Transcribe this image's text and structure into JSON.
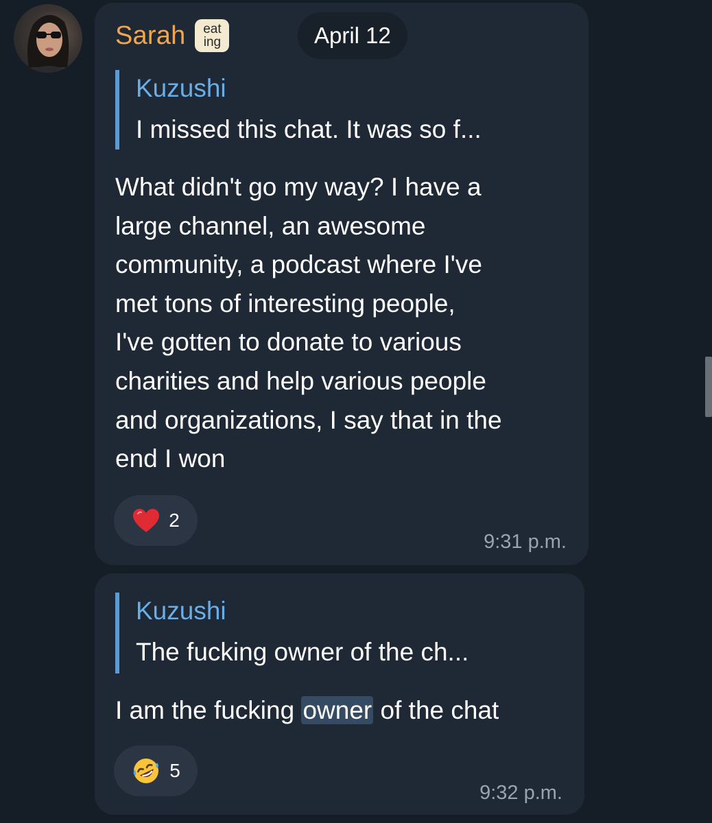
{
  "sender": {
    "name": "Sarah",
    "badge_line1": "eat",
    "badge_line2": "ing"
  },
  "date_divider": "April 12",
  "messages": [
    {
      "reply_author": "Kuzushi",
      "reply_text": "I missed this chat. It was so f...",
      "text": "What didn't go my way? I have a\nlarge channel, an awesome\ncommunity, a podcast where I've\nmet tons of interesting people,\nI've gotten to donate to various\ncharities and help various people\nand organizations, I say that in the\nend I won",
      "reaction_emoji": "red-heart",
      "reaction_count": "2",
      "time": "9:31 p.m."
    },
    {
      "reply_author": "Kuzushi",
      "reply_text": "The fucking owner of the ch...",
      "text_before": "I am the fucking ",
      "text_highlight": "owner",
      "text_after": " of the chat",
      "reaction_emoji": "rolling-on-floor-laughing",
      "reaction_count": "5",
      "time": "9:32 p.m."
    }
  ],
  "colors": {
    "background": "#151d26",
    "bubble": "#1f2835",
    "sender_name": "#f0a64b",
    "reply_accent": "#5a9bd5",
    "reply_author": "#6aaee8",
    "timestamp": "#9aa4b0",
    "highlight": "#344b63"
  }
}
